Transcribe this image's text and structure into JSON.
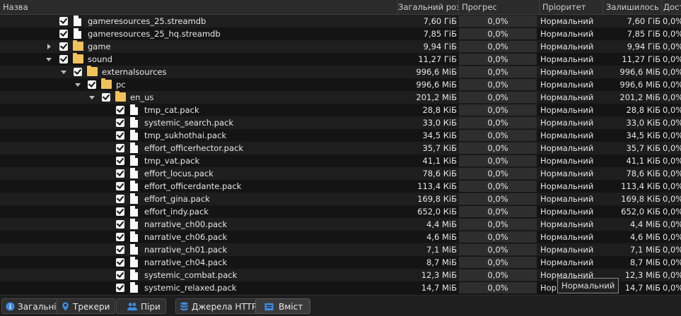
{
  "columns": {
    "name": "Назва",
    "total_size": "Загальний розмір",
    "progress": "Прогрес",
    "priority": "Пріоритет",
    "remaining": "Залишилось",
    "availability": "Дост"
  },
  "rows": [
    {
      "name": "gameresources_25.streamdb",
      "type": "file",
      "size": "7,60 ГіБ",
      "progress": "0,0%",
      "priority": "Нормальний",
      "remaining": "7,60 ГіБ",
      "availability": "0,0%"
    },
    {
      "name": "gameresources_25_hq.streamdb",
      "type": "file",
      "size": "7,85 ГіБ",
      "progress": "0,0%",
      "priority": "Нормальний",
      "remaining": "7,85 ГіБ",
      "availability": "0,0%"
    },
    {
      "name": "game",
      "type": "folder",
      "size": "9,94 ГіБ",
      "progress": "0,0%",
      "priority": "Нормальний",
      "remaining": "9,94 ГіБ",
      "availability": "0,0%"
    },
    {
      "name": "sound",
      "type": "folder",
      "size": "11,27 ГіБ",
      "progress": "0,0%",
      "priority": "Нормальний",
      "remaining": "11,27 ГіБ",
      "availability": "0,0%"
    },
    {
      "name": "externalsources",
      "type": "folder",
      "size": "996,6 МіБ",
      "progress": "0,0%",
      "priority": "Нормальний",
      "remaining": "996,6 МіБ",
      "availability": "0,0%"
    },
    {
      "name": "pc",
      "type": "folder",
      "size": "996,6 МіБ",
      "progress": "0,0%",
      "priority": "Нормальний",
      "remaining": "996,6 МіБ",
      "availability": "0,0%"
    },
    {
      "name": "en_us",
      "type": "folder",
      "size": "201,2 МіБ",
      "progress": "0,0%",
      "priority": "Нормальний",
      "remaining": "201,2 МіБ",
      "availability": "0,0%"
    },
    {
      "name": "tmp_cat.pack",
      "type": "file",
      "size": "28,8 КіБ",
      "progress": "0,0%",
      "priority": "Нормальний",
      "remaining": "28,8 КіБ",
      "availability": "0,0%"
    },
    {
      "name": "systemic_search.pack",
      "type": "file",
      "size": "33,0 КіБ",
      "progress": "0,0%",
      "priority": "Нормальний",
      "remaining": "33,0 КіБ",
      "availability": "0,0%"
    },
    {
      "name": "tmp_sukhothai.pack",
      "type": "file",
      "size": "34,5 КіБ",
      "progress": "0,0%",
      "priority": "Нормальний",
      "remaining": "34,5 КіБ",
      "availability": "0,0%"
    },
    {
      "name": "effort_officerhector.pack",
      "type": "file",
      "size": "35,7 КіБ",
      "progress": "0,0%",
      "priority": "Нормальний",
      "remaining": "35,7 КіБ",
      "availability": "0,0%"
    },
    {
      "name": "tmp_vat.pack",
      "type": "file",
      "size": "41,1 КіБ",
      "progress": "0,0%",
      "priority": "Нормальний",
      "remaining": "41,1 КіБ",
      "availability": "0,0%"
    },
    {
      "name": "effort_locus.pack",
      "type": "file",
      "size": "78,6 КіБ",
      "progress": "0,0%",
      "priority": "Нормальний",
      "remaining": "78,6 КіБ",
      "availability": "0,0%"
    },
    {
      "name": "effort_officerdante.pack",
      "type": "file",
      "size": "113,4 КіБ",
      "progress": "0,0%",
      "priority": "Нормальний",
      "remaining": "113,4 КіБ",
      "availability": "0,0%"
    },
    {
      "name": "effort_gina.pack",
      "type": "file",
      "size": "169,8 КіБ",
      "progress": "0,0%",
      "priority": "Нормальний",
      "remaining": "169,8 КіБ",
      "availability": "0,0%"
    },
    {
      "name": "effort_indy.pack",
      "type": "file",
      "size": "652,0 КіБ",
      "progress": "0,0%",
      "priority": "Нормальний",
      "remaining": "652,0 КіБ",
      "availability": "0,0%"
    },
    {
      "name": "narrative_ch00.pack",
      "type": "file",
      "size": "4,4 МіБ",
      "progress": "0,0%",
      "priority": "Нормальний",
      "remaining": "4,4 МіБ",
      "availability": "0,0%"
    },
    {
      "name": "narrative_ch06.pack",
      "type": "file",
      "size": "4,6 МіБ",
      "progress": "0,0%",
      "priority": "Нормальний",
      "remaining": "4,6 МіБ",
      "availability": "0,0%"
    },
    {
      "name": "narrative_ch01.pack",
      "type": "file",
      "size": "7,1 МіБ",
      "progress": "0,0%",
      "priority": "Нормальний",
      "remaining": "7,1 МіБ",
      "availability": "0,0%"
    },
    {
      "name": "narrative_ch04.pack",
      "type": "file",
      "size": "8,7 МіБ",
      "progress": "0,0%",
      "priority": "Нормальний",
      "remaining": "8,7 МіБ",
      "availability": "0,0%"
    },
    {
      "name": "systemic_combat.pack",
      "type": "file",
      "size": "12,3 МіБ",
      "progress": "0,0%",
      "priority": "Нормальний",
      "remaining": "12,3 МіБ",
      "availability": "0,0%"
    },
    {
      "name": "systemic_relaxed.pack",
      "type": "file",
      "size": "14,7 МіБ",
      "progress": "0,0%",
      "priority": "Нор",
      "remaining": "14,7 МіБ",
      "availability": "0,0%"
    }
  ],
  "tooltip": "Нормальний",
  "tabs": [
    {
      "label": "Загальні",
      "icon": "info-icon"
    },
    {
      "label": "Трекери",
      "icon": "location-pin-icon"
    },
    {
      "label": "Піри",
      "icon": "users-icon"
    },
    {
      "label": "Джерела HTTP",
      "icon": "database-icon"
    },
    {
      "label": "Вміст",
      "icon": "folder-content-icon"
    }
  ],
  "colors": {
    "accent": "#3d8be0",
    "folder": "#f1c15b",
    "background": "#141414"
  }
}
